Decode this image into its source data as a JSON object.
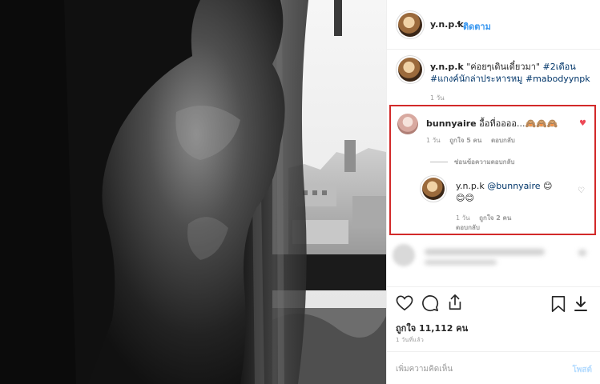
{
  "post": {
    "username": "y.n.p.k",
    "separator": "•",
    "follow_label": "ติดตาม"
  },
  "caption": {
    "username": "y.n.p.k",
    "text_plain": " \"ค่อยๆเดินเดี๋ยวมา\" ",
    "tag1": "#2เดือน",
    "tag2": "#แกงค์นักล่าประหารหมู",
    "tag3": "#mabodyynpk",
    "time": "1 วัน"
  },
  "comments": [
    {
      "username": "bunnyaire",
      "text": " อื้อที่ออออ...🙈🙈🙈",
      "time": "1 วัน",
      "likes": "ถูกใจ 5 คน",
      "reply": "ตอบกลับ",
      "liked": true
    }
  ],
  "hide_replies_label": "ซ่อนข้อความตอบกลับ",
  "reply": {
    "username": "y.n.p.k",
    "mention": "@bunnyaire",
    "emoji": "😊😊😊",
    "time": "1 วัน",
    "likes": "ถูกใจ 2 คน",
    "reply": "ตอบกลับ"
  },
  "stats": {
    "likes": "ถูกใจ 11,112 คน",
    "age": "1 วันที่แล้ว"
  },
  "add_comment": {
    "placeholder": "เพิ่มความคิดเห็น",
    "post_label": "โพสต์"
  },
  "icons": [
    "heart-icon",
    "comment-icon",
    "share-icon",
    "bookmark-icon"
  ],
  "colors": {
    "link": "#3897f0",
    "hashtag": "#003569",
    "like_red": "#ed4956",
    "highlight_border": "#d22a2a"
  }
}
